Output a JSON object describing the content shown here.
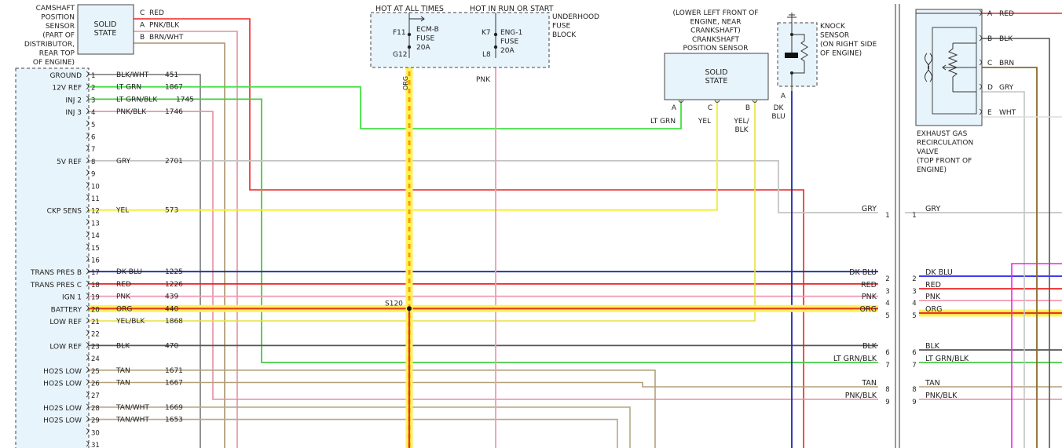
{
  "camshaft_sensor": {
    "caption": [
      "CAMSHAFT",
      "POSITION",
      "SENSOR",
      "(PART OF",
      "DISTRIBUTOR,",
      "REAR TOP",
      "OF ENGINE)"
    ],
    "label": [
      "SOLID",
      "STATE"
    ],
    "pins": [
      {
        "pin": "C",
        "color": "RED",
        "hex": "#ee2222"
      },
      {
        "pin": "A",
        "color": "PNK/BLK",
        "hex": "#e29aa8"
      },
      {
        "pin": "B",
        "color": "BRN/WHT",
        "hex": "#a8926a"
      }
    ]
  },
  "ecm_pins": [
    {
      "num": "1",
      "name": "GROUND",
      "color": "BLK/WHT",
      "circuit": "451"
    },
    {
      "num": "2",
      "name": "12V REF",
      "color": "LT GRN",
      "circuit": "1867"
    },
    {
      "num": "3",
      "name": "INJ 2",
      "color": "LT GRN/BLK",
      "circuit": "1745"
    },
    {
      "num": "4",
      "name": "INJ 3",
      "color": "PNK/BLK",
      "circuit": "1746"
    },
    {
      "num": "5",
      "name": "",
      "color": "",
      "circuit": ""
    },
    {
      "num": "6",
      "name": "",
      "color": "",
      "circuit": ""
    },
    {
      "num": "7",
      "name": "",
      "color": "",
      "circuit": ""
    },
    {
      "num": "8",
      "name": "5V REF",
      "color": "GRY",
      "circuit": "2701"
    },
    {
      "num": "9",
      "name": "",
      "color": "",
      "circuit": ""
    },
    {
      "num": "10",
      "name": "",
      "color": "",
      "circuit": ""
    },
    {
      "num": "11",
      "name": "",
      "color": "",
      "circuit": ""
    },
    {
      "num": "12",
      "name": "CKP SENS",
      "color": "YEL",
      "circuit": "573"
    },
    {
      "num": "13",
      "name": "",
      "color": "",
      "circuit": ""
    },
    {
      "num": "14",
      "name": "",
      "color": "",
      "circuit": ""
    },
    {
      "num": "15",
      "name": "",
      "color": "",
      "circuit": ""
    },
    {
      "num": "16",
      "name": "",
      "color": "",
      "circuit": ""
    },
    {
      "num": "17",
      "name": "TRANS PRES B",
      "color": "DK BLU",
      "circuit": "1225"
    },
    {
      "num": "18",
      "name": "TRANS PRES C",
      "color": "RED",
      "circuit": "1226"
    },
    {
      "num": "19",
      "name": "IGN 1",
      "color": "PNK",
      "circuit": "439"
    },
    {
      "num": "20",
      "name": "BATTERY",
      "color": "ORG",
      "circuit": "440"
    },
    {
      "num": "21",
      "name": "LOW REF",
      "color": "YEL/BLK",
      "circuit": "1868"
    },
    {
      "num": "22",
      "name": "",
      "color": "",
      "circuit": ""
    },
    {
      "num": "23",
      "name": "LOW REF",
      "color": "BLK",
      "circuit": "470"
    },
    {
      "num": "24",
      "name": "",
      "color": "",
      "circuit": ""
    },
    {
      "num": "25",
      "name": "HO2S LOW",
      "color": "TAN",
      "circuit": "1671"
    },
    {
      "num": "26",
      "name": "HO2S LOW",
      "color": "TAN",
      "circuit": "1667"
    },
    {
      "num": "27",
      "name": "",
      "color": "",
      "circuit": ""
    },
    {
      "num": "28",
      "name": "HO2S LOW",
      "color": "TAN/WHT",
      "circuit": "1669"
    },
    {
      "num": "29",
      "name": "HO2S LOW",
      "color": "TAN/WHT",
      "circuit": "1653"
    },
    {
      "num": "30",
      "name": "",
      "color": "",
      "circuit": ""
    },
    {
      "num": "31",
      "name": "",
      "color": "",
      "circuit": ""
    }
  ],
  "fuse_block": {
    "hot_always": "HOT AT ALL TIMES",
    "hot_run": "HOT IN RUN OR START",
    "caption": [
      "UNDERHOOD",
      "FUSE",
      "BLOCK"
    ],
    "fuse1": {
      "top": "F11",
      "bottom": "G12",
      "lines": [
        "ECM-B",
        "FUSE",
        "20A"
      ]
    },
    "fuse2": {
      "top": "K7",
      "bottom": "L8",
      "lines": [
        "ENG-1",
        "FUSE",
        "20A"
      ]
    },
    "wire1": "ORG",
    "wire2": "PNK"
  },
  "crank_sensor": {
    "caption": [
      "(LOWER LEFT FRONT OF",
      "ENGINE, NEAR",
      "CRANKSHAFT)",
      "CRANKSHAFT",
      "POSITION SENSOR"
    ],
    "label": [
      "SOLID",
      "STATE"
    ],
    "pins": [
      {
        "pin": "A",
        "color": [
          "LT GRN"
        ]
      },
      {
        "pin": "C",
        "color": [
          "YEL"
        ]
      },
      {
        "pin": "B",
        "color": [
          "YEL/",
          "BLK"
        ]
      }
    ]
  },
  "knock_sensor": {
    "caption": [
      "KNOCK",
      "SENSOR",
      "(ON RIGHT SIDE",
      "OF ENGINE)"
    ],
    "pin": "A",
    "color": [
      "DK",
      "BLU"
    ]
  },
  "splice": "S120",
  "connector": {
    "left": [
      {
        "num": "1",
        "color": "GRY"
      },
      {
        "num": "2",
        "color": "DK BLU"
      },
      {
        "num": "3",
        "color": "RED"
      },
      {
        "num": "4",
        "color": "PNK"
      },
      {
        "num": "5",
        "color": "ORG"
      },
      {
        "num": "6",
        "color": "BLK"
      },
      {
        "num": "7",
        "color": "LT GRN/BLK"
      },
      {
        "num": "8",
        "color": "TAN"
      },
      {
        "num": "9",
        "color": "PNK/BLK"
      }
    ],
    "right": [
      {
        "num": "1",
        "color": "GRY"
      },
      {
        "num": "2",
        "color": "DK BLU"
      },
      {
        "num": "3",
        "color": "RED"
      },
      {
        "num": "4",
        "color": "PNK"
      },
      {
        "num": "5",
        "color": "ORG"
      },
      {
        "num": "6",
        "color": "BLK"
      },
      {
        "num": "7",
        "color": "LT GRN/BLK"
      },
      {
        "num": "8",
        "color": "TAN"
      },
      {
        "num": "9",
        "color": "PNK/BLK"
      }
    ]
  },
  "egr_valve": {
    "caption": [
      "EXHAUST GAS",
      "RECIRCULATION",
      "VALVE",
      "(TOP FRONT OF",
      "ENGINE)"
    ],
    "pins": [
      {
        "pin": "A",
        "color": "RED"
      },
      {
        "pin": "B",
        "color": "BLK"
      },
      {
        "pin": "C",
        "color": "BRN"
      },
      {
        "pin": "D",
        "color": "GRY"
      },
      {
        "pin": "E",
        "color": "WHT"
      }
    ]
  },
  "wire_colors": {
    "RED": "#ee2222",
    "PNK": "#f29ab0",
    "PNK/BLK": "#e58fa3",
    "BRN/WHT": "#a8926a",
    "LT GRN": "#44e044",
    "LT GRN/BLK": "#44cc44",
    "GRY": "#c4c4c4",
    "YEL": "#f2ee2c",
    "YEL/BLK": "#e6e040",
    "DK BLU": "#1c2aa0",
    "BLK": "#555555",
    "BLK/WHT": "#777777",
    "TAN": "#b3a07a",
    "TAN/WHT": "#b7a887",
    "ORG": "#f0d000",
    "BRN": "#8a6a2a",
    "MAGENTA": "#ee22ee",
    "BLUE": "#2222ee"
  }
}
